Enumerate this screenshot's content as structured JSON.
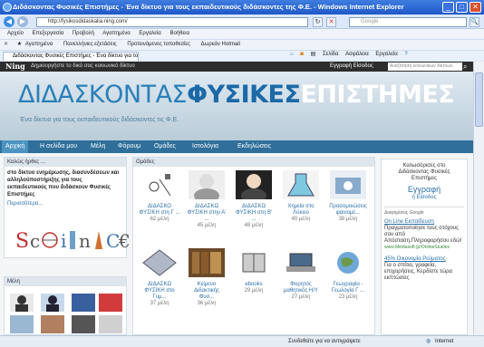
{
  "window": {
    "title": "Διδάσκοντας Φυσικές Επιστήμες - Ένα δίκτυο για τους εκπαιδευτικούς διδάσκοντες της Φ.Ε. - Windows Internet Explorer",
    "btn_min": "_",
    "btn_max": "□",
    "btn_close": "✕"
  },
  "address_bar": {
    "back": "◀",
    "forward": "▶",
    "url": "http://fysikosdidaskalia.ning.com/",
    "search_placeholder": "Google",
    "refresh": "↻",
    "stop": "✕",
    "search_btn": "🔍"
  },
  "menu": [
    "Αρχείο",
    "Επεξεργασία",
    "Προβολή",
    "Αγαπημένα",
    "Εργαλεία",
    "Βοήθεια"
  ],
  "links_bar": {
    "close": "✕",
    "items": [
      "Αγαπημένα",
      "Πανελλήνιες εξετάσεις",
      "Προτεινόμενες τοποθεσίες",
      "Δωρεάν Hotmail"
    ]
  },
  "tab": {
    "title": "Διδάσκοντας Φυσικές Επιστήμες - Ένα δίκτυο για τους ε..."
  },
  "command_bar": {
    "items": [
      "Σελίδα",
      "Ασφάλεια",
      "Εργαλεία"
    ]
  },
  "ning": {
    "logo": "Ning",
    "tagline": "Δημιουργήστε το δικό σας κοινωνικό δίκτυο",
    "signup": "Εγγραφή   Είσοδος",
    "search_placeholder": "Αναζήτηση κοινωνικών δικτύων",
    "search_icon": "⌕"
  },
  "site": {
    "title_part1": "ΔΙΔΑΣΚΟΝΤΑΣ",
    "title_part2": "ΦΥΣΙΚΕΣ",
    "title_part3": "ΕΠΙΣΤΗΜΕΣ",
    "subtitle": "Ένα δίκτυο για τους εκπαιδευτικούς διδάσκοντες τις Φ.Ε."
  },
  "nav": [
    "Αρχική",
    "Η σελίδα μου",
    "Μέλη",
    "Φόρουμ",
    "Ομάδες",
    "Ιστολόγια",
    "Εκδηλώσεις"
  ],
  "welcome": {
    "header": "Καλώς ήρθες ...",
    "text": "στο δίκτυο ενημέρωσης, διασυνδέσεων και αλληλοϋποστήριξης για τους εκπαιδευτικούς που διδάσκουν Φυσικές Επιστήμες",
    "more": "Περισσότερα..."
  },
  "groups": {
    "header": "Ομάδες",
    "items": [
      {
        "name": "ΔΙΔΑΣΚΟ ΦΥΣΙΚΗ στη Γ ...",
        "count": "62 μέλη"
      },
      {
        "name": "ΔΙΔΑΣΚΩ ΦΥΣΙΚΗ στην Α' ...",
        "count": "45 μέλη"
      },
      {
        "name": "ΔΙΔΑΣΚΩ ΦΥΣΙΚΗ στη Β' ...",
        "count": "48 μέλη"
      },
      {
        "name": "Χημεία στο Λύκειο",
        "count": "40 μέλη"
      },
      {
        "name": "Προσομοιώσεις φαινομέ...",
        "count": "38 μέλη"
      },
      {
        "name": "ΔΙΔΑΣΚΩ ΦΥΣΙΚΗ στο Γυμ...",
        "count": "37 μέλη"
      },
      {
        "name": "Κείμενο Διδακτικής Φυσ...",
        "count": "36 μέλη"
      },
      {
        "name": "ebooks",
        "count": "29 μέλη"
      },
      {
        "name": "Φορητός μαθητικός Η/Υ",
        "count": "27 μέλη"
      },
      {
        "name": "Γεωγραφία - Γεωλογία Γ ...",
        "count": "23 μέλη"
      }
    ]
  },
  "members": {
    "header": "Μέλη"
  },
  "sidebar": {
    "welcome_line1": "Καλωσόρισες στο",
    "welcome_line2": "Διδάσκοντας Φυσικές",
    "welcome_line3": "Επιστήμες",
    "signup": "Εγγραφή",
    "or_login": "ή Είσοδος",
    "ads_label": "Διαφημίσεις Google",
    "ad1_title": "On Line Εκπαίδευση",
    "ad1_text": "Πραγματοποίησε τους στόχους σου από Απόσταση.Πληροφορήσου εδώ!",
    "ad1_url": "www.Mediasoft.gr/OnlineStudies",
    "ad2_title": "45% Οικονομία Ρεύματος",
    "ad2_text": "Για ο σπίτια, γραφεία, επιχειρήσεις. Κερδίστε τώρα εκπτώσεις"
  },
  "status": {
    "text": "Συνδεθείτε για να αντιγράψετε",
    "zone": "Internet"
  },
  "colors": {
    "title_bar": "#1f58c8",
    "nav_bg": "#2f6f9a",
    "link": "#2a6fa8"
  }
}
